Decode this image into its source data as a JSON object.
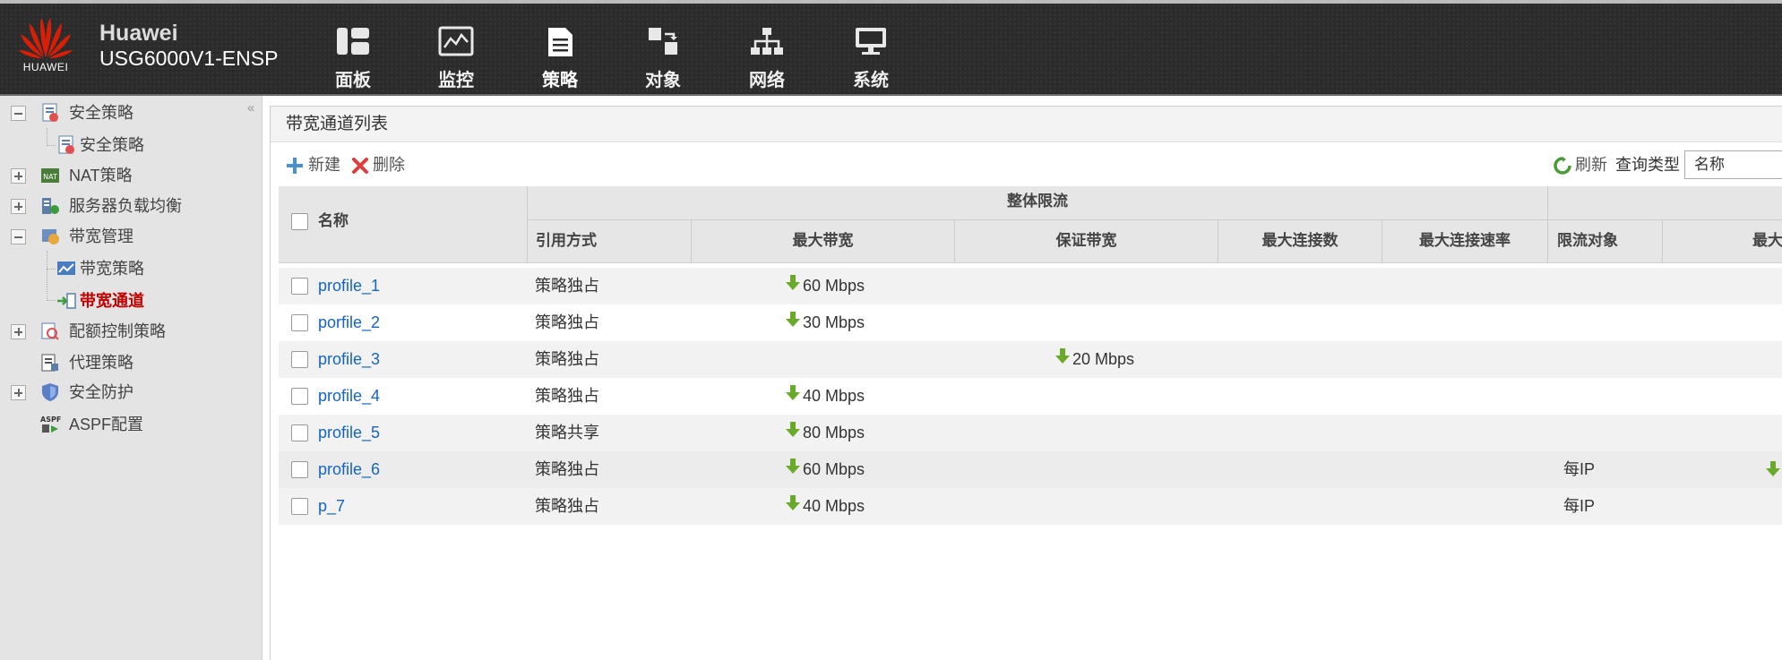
{
  "brand": {
    "logo_text": "HUAWEI",
    "name": "Huawei",
    "model": "USG6000V1-ENSP"
  },
  "nav": [
    {
      "label": "面板",
      "icon": "dashboard-icon"
    },
    {
      "label": "监控",
      "icon": "monitor-icon"
    },
    {
      "label": "策略",
      "icon": "policy-icon"
    },
    {
      "label": "对象",
      "icon": "object-icon"
    },
    {
      "label": "网络",
      "icon": "network-icon"
    },
    {
      "label": "系统",
      "icon": "system-icon"
    }
  ],
  "sidebar": {
    "collapse_glyph": "«",
    "items": [
      {
        "label": "安全策略",
        "expander": "minus",
        "icon": "security-policy-icon"
      },
      {
        "label": "安全策略",
        "expander": "",
        "icon": "security-policy-icon"
      },
      {
        "label": "NAT策略",
        "expander": "plus",
        "icon": "nat-icon"
      },
      {
        "label": "服务器负载均衡",
        "expander": "plus",
        "icon": "server-lb-icon"
      },
      {
        "label": "带宽管理",
        "expander": "minus",
        "icon": "bandwidth-mgmt-icon"
      },
      {
        "label": "带宽策略",
        "expander": "",
        "icon": "bandwidth-policy-icon"
      },
      {
        "label": "带宽通道",
        "expander": "",
        "icon": "bandwidth-channel-icon",
        "selected": true
      },
      {
        "label": "配额控制策略",
        "expander": "plus",
        "icon": "quota-icon"
      },
      {
        "label": "代理策略",
        "expander": "",
        "icon": "proxy-icon"
      },
      {
        "label": "安全防护",
        "expander": "plus",
        "icon": "shield-icon"
      },
      {
        "label": "ASPF配置",
        "expander": "",
        "icon": "aspf-icon"
      }
    ]
  },
  "page": {
    "title": "带宽通道列表"
  },
  "toolbar": {
    "new_label": "新建",
    "delete_label": "删除",
    "refresh_label": "刷新",
    "query_type_label": "查询类型",
    "query_type_value": "名称"
  },
  "table": {
    "group_header": "整体限流",
    "col_name": "名称",
    "columns": [
      "引用方式",
      "最大带宽",
      "保证带宽",
      "最大连接数",
      "最大连接速率",
      "限流对象",
      "最大"
    ],
    "rows": [
      {
        "name": "profile_1",
        "ref": "策略独占",
        "max_bw": "60 Mbps",
        "guar_bw": "",
        "target": "",
        "right_arrow": false
      },
      {
        "name": "porfile_2",
        "ref": "策略独占",
        "max_bw": "30 Mbps",
        "guar_bw": "",
        "target": "",
        "right_arrow": false
      },
      {
        "name": "profile_3",
        "ref": "策略独占",
        "max_bw": "",
        "guar_bw": "20 Mbps",
        "target": "",
        "right_arrow": false
      },
      {
        "name": "profile_4",
        "ref": "策略独占",
        "max_bw": "40 Mbps",
        "guar_bw": "",
        "target": "",
        "right_arrow": false
      },
      {
        "name": "profile_5",
        "ref": "策略共享",
        "max_bw": "80 Mbps",
        "guar_bw": "",
        "target": "",
        "right_arrow": false
      },
      {
        "name": "profile_6",
        "ref": "策略独占",
        "max_bw": "60 Mbps",
        "guar_bw": "",
        "target": "每IP",
        "right_arrow": true
      },
      {
        "name": "p_7",
        "ref": "策略独占",
        "max_bw": "40 Mbps",
        "guar_bw": "",
        "target": "每IP",
        "right_arrow": false
      }
    ]
  },
  "colors": {
    "topbar": "#2b2b2b",
    "link": "#1565c0",
    "selected": "#c00000",
    "arrow": "#6aaa2a",
    "logo_red": "#d81e06"
  }
}
